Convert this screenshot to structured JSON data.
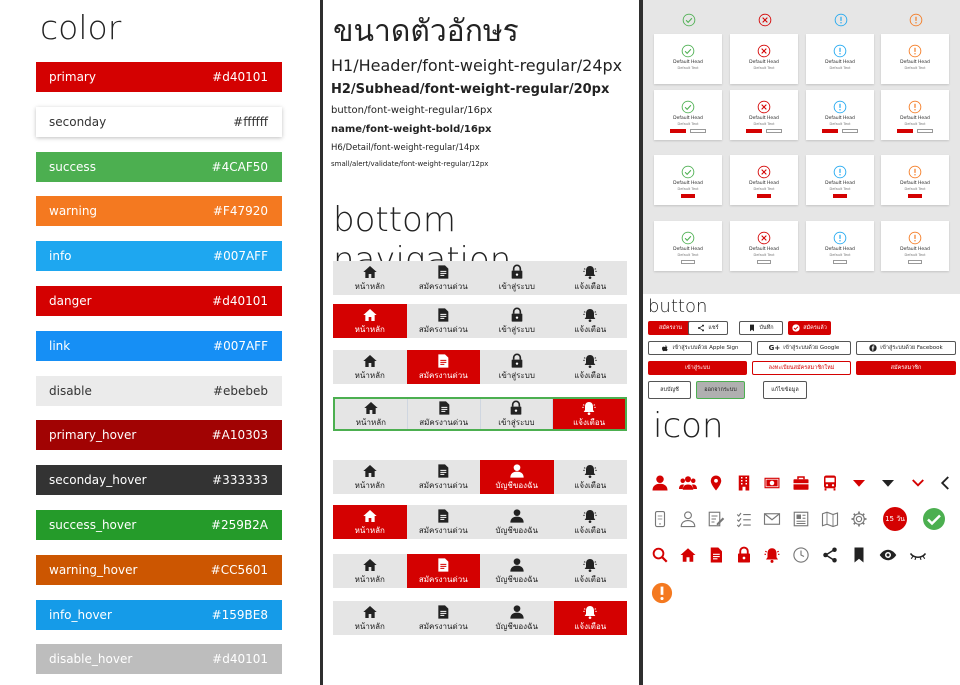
{
  "colors": {
    "title": "color",
    "swatches": [
      {
        "name": "primary",
        "hex": "#d40101",
        "bg": "#d40101",
        "fg": "#ffffff"
      },
      {
        "name": "seconday",
        "hex": "#ffffff",
        "bg": "#ffffff",
        "fg": "#333333"
      },
      {
        "name": "success",
        "hex": "#4CAF50",
        "bg": "#4caf50",
        "fg": "#ffffff"
      },
      {
        "name": "warning",
        "hex": "#F47920",
        "bg": "#f47920",
        "fg": "#ffffff"
      },
      {
        "name": "info",
        "hex": "#007AFF",
        "bg": "#1ea7f0",
        "fg": "#ffffff"
      },
      {
        "name": "danger",
        "hex": "#d40101",
        "bg": "#d40101",
        "fg": "#ffffff"
      },
      {
        "name": "link",
        "hex": "#007AFF",
        "bg": "#168ff5",
        "fg": "#ffffff"
      },
      {
        "name": "disable",
        "hex": "#ebebeb",
        "bg": "#ebebeb",
        "fg": "#333333"
      },
      {
        "name": "primary_hover",
        "hex": "#A10303",
        "bg": "#a10303",
        "fg": "#ffffff"
      },
      {
        "name": "seconday_hover",
        "hex": "#333333",
        "bg": "#333333",
        "fg": "#ffffff"
      },
      {
        "name": "success_hover",
        "hex": "#259B2A",
        "bg": "#259b2a",
        "fg": "#ffffff"
      },
      {
        "name": "warning_hover",
        "hex": "#CC5601",
        "bg": "#cc5601",
        "fg": "#ffffff"
      },
      {
        "name": "info_hover",
        "hex": "#159BE8",
        "bg": "#159be8",
        "fg": "#ffffff"
      },
      {
        "name": "disable_hover",
        "hex": "#d40101",
        "bg": "#bdbdbd",
        "fg": "#ffffff"
      }
    ]
  },
  "typography": {
    "title": "ขนาดตัวอักษร",
    "h1": "H1/Header/font-weight-regular/24px",
    "h2": "H2/Subhead/font-weight-regular/20px",
    "button": "button/font-weight-regular/16px",
    "name": "name/font-weight-bold/16px",
    "h6": "H6/Detail/font-weight-regular/14px",
    "small": "small/alert/validate/font-weight-regular/12px"
  },
  "bottom_nav": {
    "title": "bottom navigation",
    "labels": {
      "home": "หน้าหลัก",
      "apply": "สมัครงานด่วน",
      "login": "เข้าสู่ระบบ",
      "account": "บัญชีของฉัน",
      "notify": "แจ้งเตือน"
    }
  },
  "alerts": {
    "head": "Default Head",
    "text": "Default Text",
    "colors": {
      "success": "#4caf50",
      "danger": "#d40101",
      "info": "#1ea7f0",
      "warning": "#f47920"
    }
  },
  "buttons": {
    "title": "button",
    "apply": "สมัครงาน",
    "share": "แชร์",
    "save": "บันทึก",
    "applied": "สมัครแล้ว",
    "apple": "เข้าสู่ระบบด้วย Apple Sign",
    "google": "เข้าสู่ระบบด้วย Google",
    "facebook": "เข้าสู่ระบบด้วย Facebook",
    "login": "เข้าสู่ระบบ",
    "register_member": "ลงทะเบียนสมัครสมาชิกใหม่",
    "register": "สมัครสมาชิก",
    "delete_account": "ลบบัญชี",
    "logout": "ออกจากระบบ",
    "edit_info": "แก้ไขข้อมูล"
  },
  "icons": {
    "title": "icon",
    "badge_15": "15 วัน",
    "red": "#d40101",
    "dark": "#222222",
    "grey": "#777777"
  }
}
